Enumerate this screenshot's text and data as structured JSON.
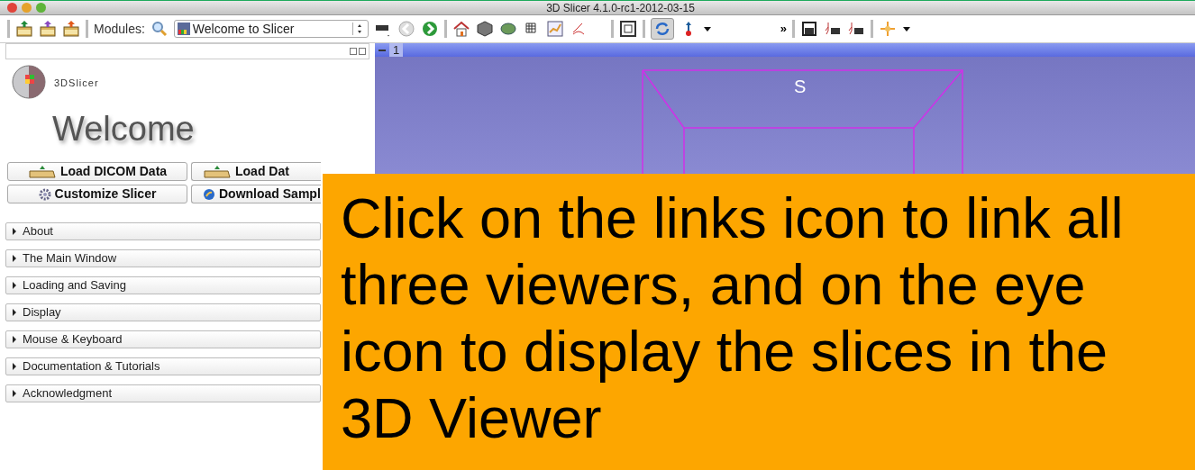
{
  "window": {
    "title": "3D Slicer 4.1.0-rc1-2012-03-15"
  },
  "toolbar": {
    "modules_label": "Modules:",
    "module_select": "Welcome to Slicer",
    "overflow": "»",
    "link_button": {
      "on": true
    }
  },
  "module_panel": {
    "logo_text": "3DSlicer",
    "heading": "Welcome",
    "buttons": [
      {
        "label": "Load DICOM Data",
        "kind": "dicom"
      },
      {
        "label": "Load Dat",
        "kind": "data"
      },
      {
        "label": "Customize Slicer",
        "kind": "gear"
      },
      {
        "label": "Download Sampl",
        "kind": "globe"
      }
    ],
    "sections": [
      {
        "label": "About",
        "expanded": false
      },
      {
        "label": "The Main Window",
        "expanded": false
      },
      {
        "label": "Loading and Saving",
        "expanded": false
      },
      {
        "label": "Display",
        "expanded": false
      },
      {
        "label": "Mouse & Keyboard",
        "expanded": false
      },
      {
        "label": "Documentation & Tutorials",
        "expanded": false
      },
      {
        "label": "Acknowledgment",
        "expanded": false
      }
    ]
  },
  "viewer": {
    "tab": "1",
    "orientation_label": "S"
  },
  "callout": {
    "text": "Click on the links icon to link all three viewers, and on the eye icon to display the slices in the 3D Viewer"
  }
}
